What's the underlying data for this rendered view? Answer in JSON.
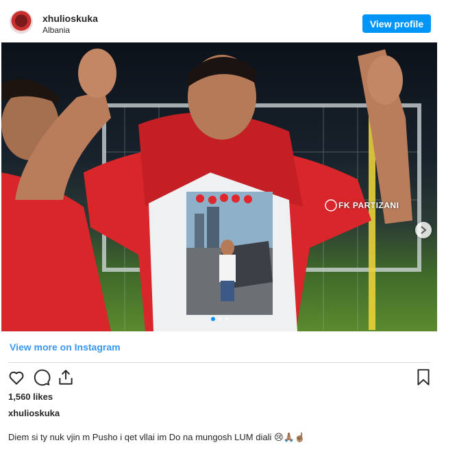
{
  "post": {
    "username": "xhulioskuka",
    "location": "Albania",
    "view_profile_label": "View profile",
    "watermark": "FK PARTIZANI",
    "slide_count": 3,
    "active_slide": 1,
    "view_more_label": "View more on Instagram",
    "likes": "1,560 likes",
    "caption_username": "xhulioskuka",
    "caption": "Diem si ty nuk vjin m Pusho i qet vllai im Do na mungosh LUM diali 😢🙏🏽☝🏽"
  },
  "colors": {
    "accent": "#0095f6",
    "link": "#3897f0",
    "jersey_red": "#d8262b"
  },
  "icons": [
    "heart-icon",
    "comment-icon",
    "share-icon",
    "bookmark-icon",
    "chevron-right-icon"
  ]
}
